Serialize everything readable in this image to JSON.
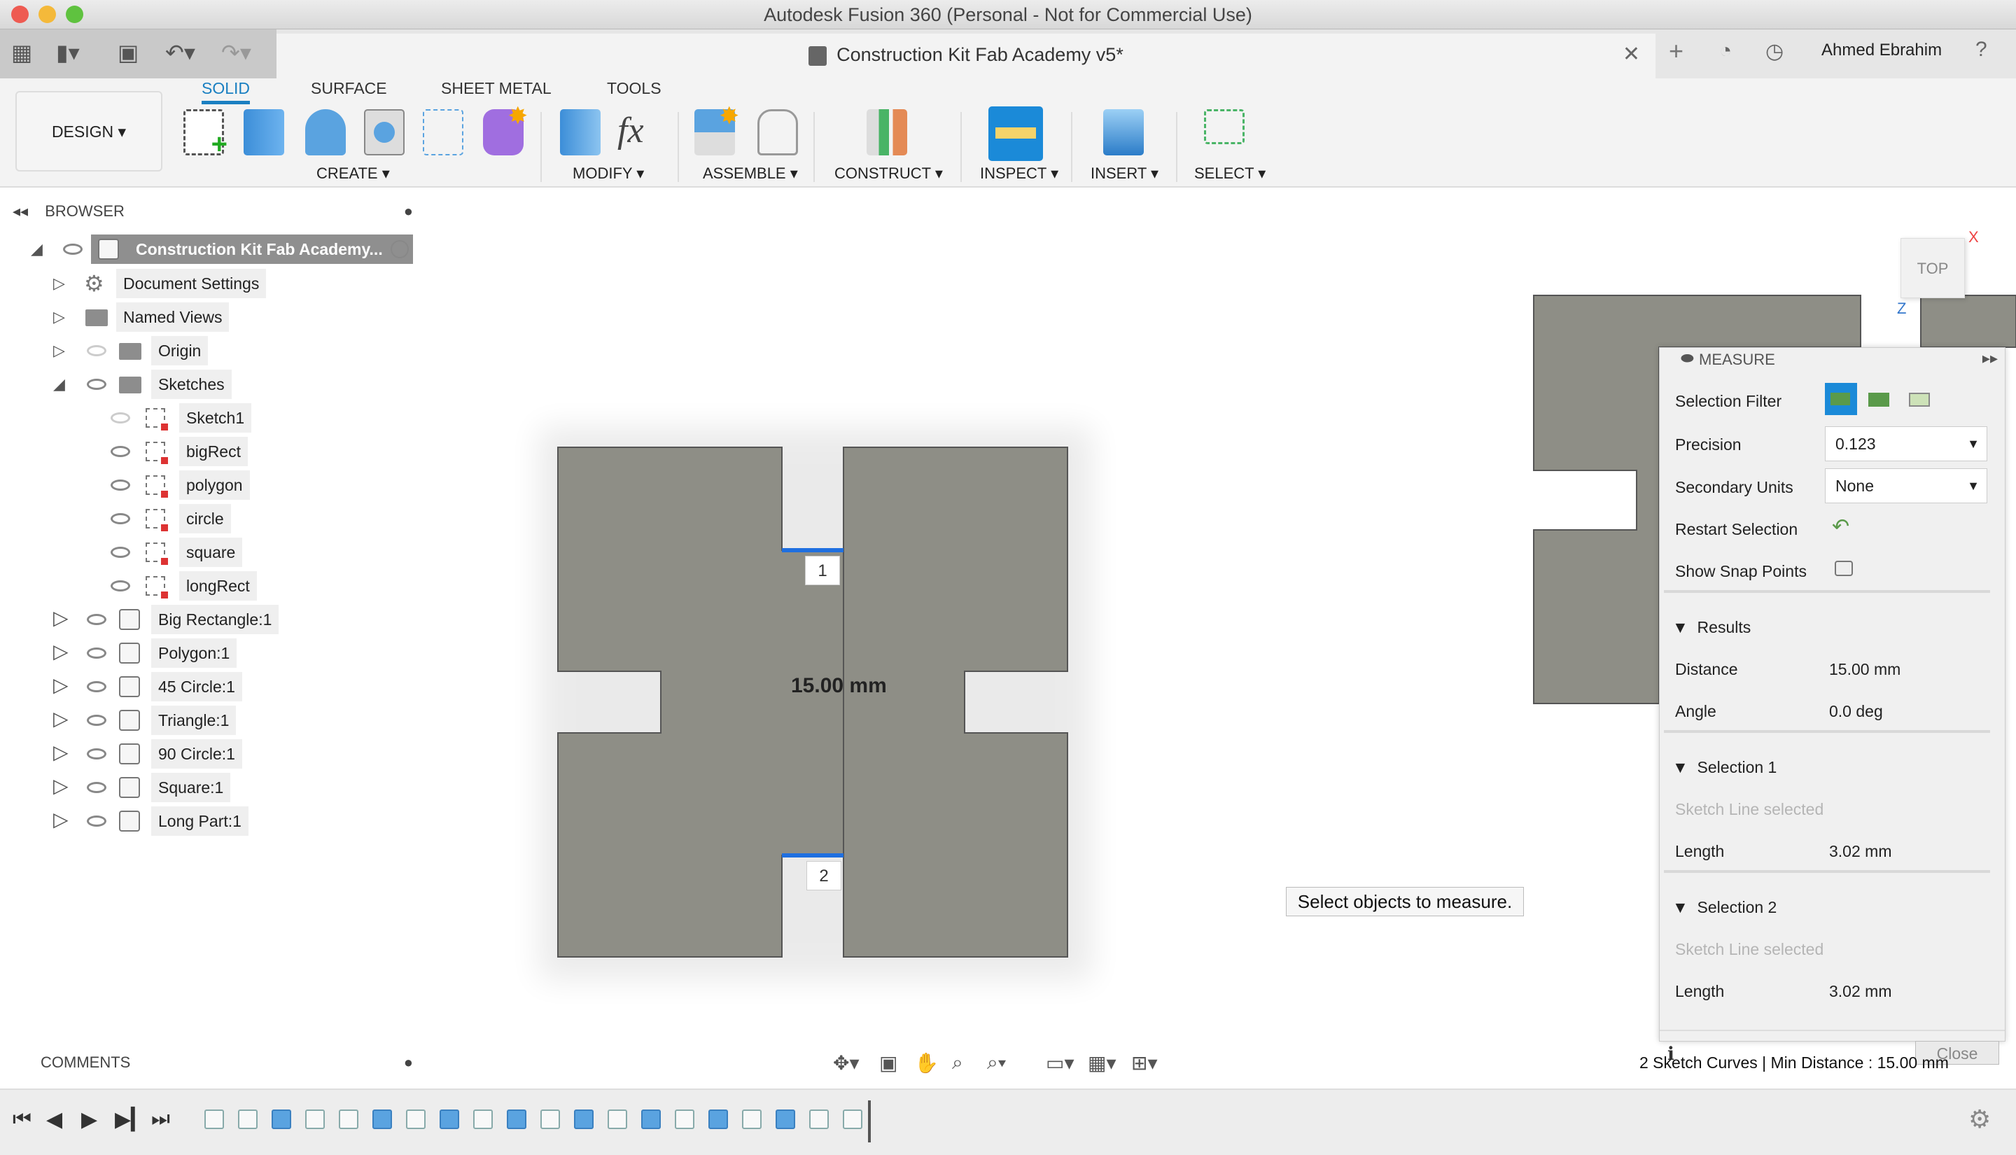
{
  "window": {
    "title": "Autodesk Fusion 360 (Personal - Not for Commercial Use)",
    "document_tab": "Construction Kit Fab Academy v5*",
    "user": "Ahmed Ebrahim"
  },
  "toolbar": {
    "workspace": "DESIGN ▾",
    "tabs": [
      "SOLID",
      "SURFACE",
      "SHEET METAL",
      "TOOLS"
    ],
    "active_tab": "SOLID",
    "groups": [
      "CREATE ▾",
      "MODIFY ▾",
      "ASSEMBLE ▾",
      "CONSTRUCT ▾",
      "INSPECT ▾",
      "INSERT ▾",
      "SELECT ▾"
    ]
  },
  "browser": {
    "title": "BROWSER",
    "root": "Construction Kit Fab Academy...",
    "items": [
      {
        "label": "Document Settings",
        "icon": "gear-icon"
      },
      {
        "label": "Named Views",
        "icon": "folder-icon"
      },
      {
        "label": "Origin",
        "icon": "folder-icon"
      },
      {
        "label": "Sketches",
        "icon": "folder-icon"
      }
    ],
    "sketches": [
      "Sketch1",
      "bigRect",
      "polygon",
      "circle",
      "square",
      "longRect"
    ],
    "components": [
      "Big Rectangle:1",
      "Polygon:1",
      "45 Circle:1",
      "Triangle:1",
      "90 Circle:1",
      "Square:1",
      "Long Part:1"
    ]
  },
  "comments": {
    "title": "COMMENTS"
  },
  "canvas": {
    "dimension": "15.00 mm",
    "marker1": "1",
    "marker2": "2",
    "tooltip": "Select objects to measure.",
    "viewcube": "TOP",
    "status": "2 Sketch Curves | Min Distance : 15.00 mm",
    "shape_color": "#8e8e86",
    "selection_color": "#1f6fe0"
  },
  "measure": {
    "title": "MEASURE",
    "selection_filter": "Selection Filter",
    "precision_label": "Precision",
    "precision": "0.123",
    "secondary_units_label": "Secondary Units",
    "secondary_units": "None",
    "restart_label": "Restart Selection",
    "snap_label": "Show Snap Points",
    "snap_checked": false,
    "results": {
      "title": "Results",
      "distance_label": "Distance",
      "distance": "15.00 mm",
      "angle_label": "Angle",
      "angle": "0.0 deg"
    },
    "selection1": {
      "title": "Selection 1",
      "type": "Sketch Line selected",
      "length_label": "Length",
      "length": "3.02 mm"
    },
    "selection2": {
      "title": "Selection 2",
      "type": "Sketch Line selected",
      "length_label": "Length",
      "length": "3.02 mm"
    },
    "close": "Close"
  }
}
